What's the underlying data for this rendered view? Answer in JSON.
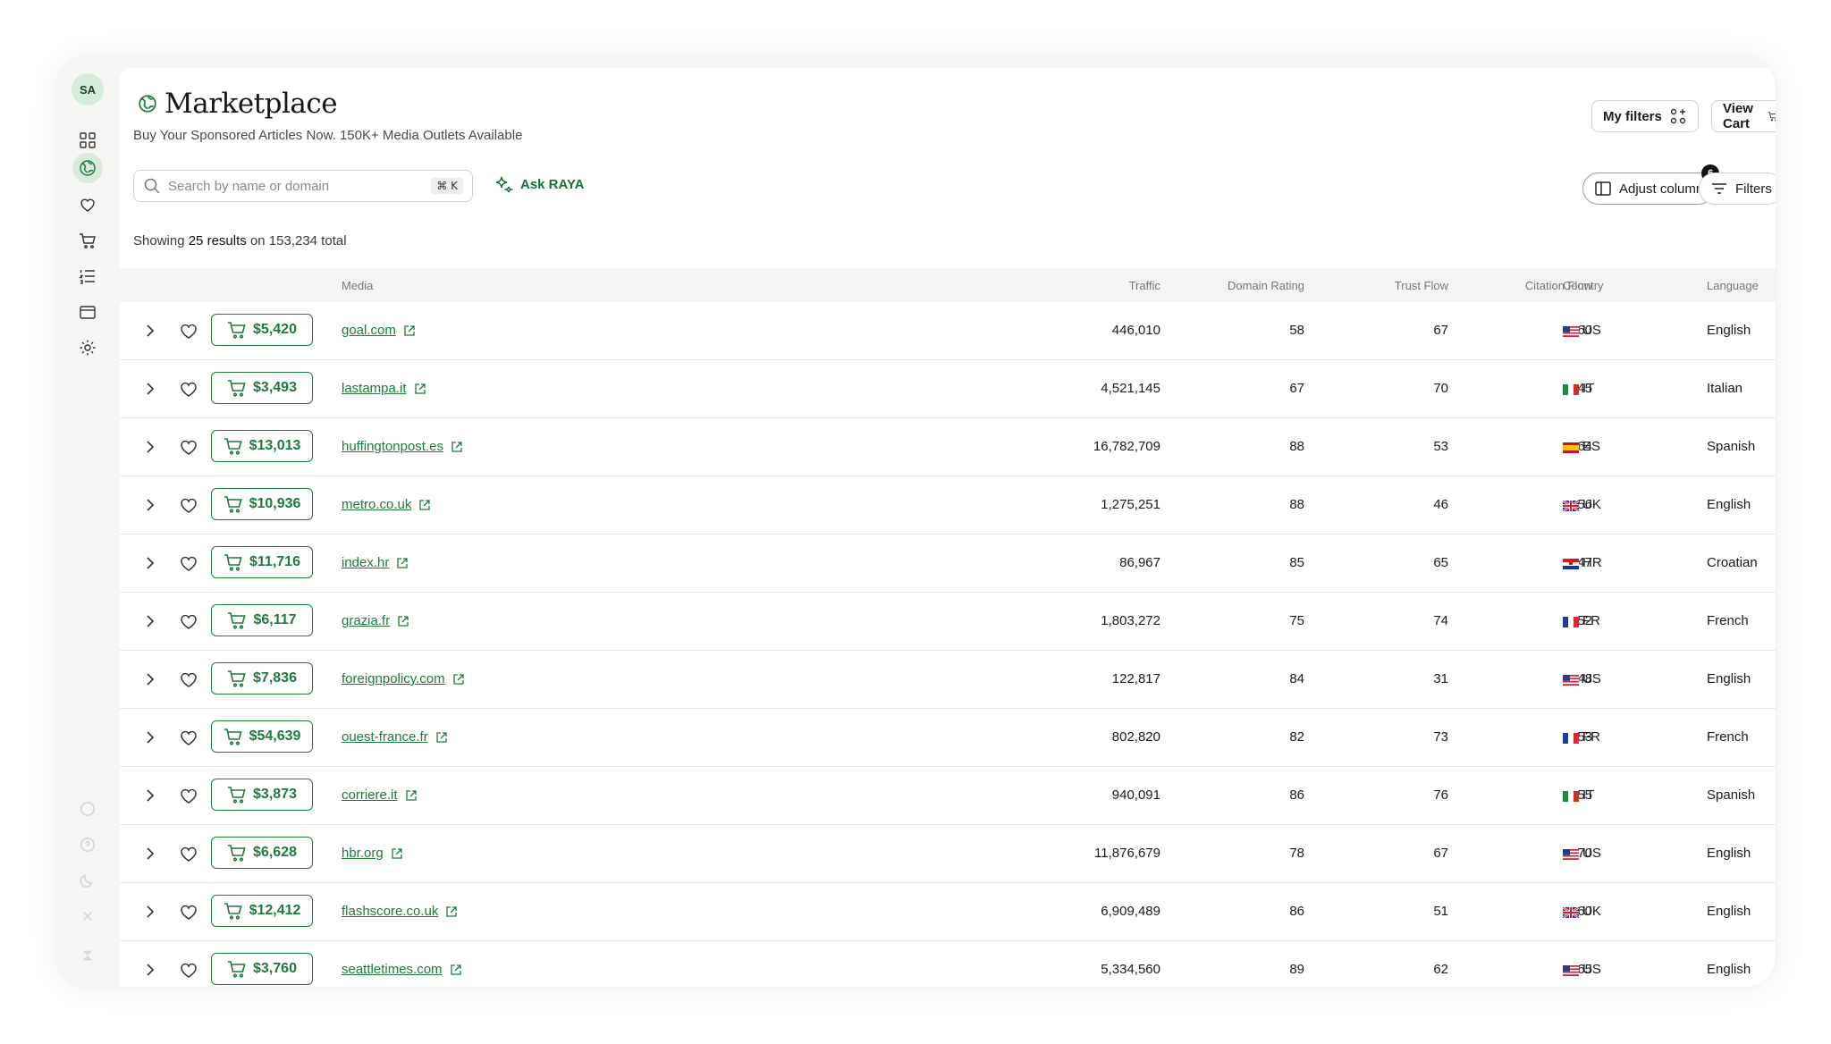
{
  "sidebar": {
    "avatar": "SA",
    "items": [
      "dashboard-icon",
      "globe-icon",
      "heart-icon",
      "cart-icon",
      "list-icon",
      "wallet-icon",
      "gear-icon"
    ]
  },
  "header": {
    "title": "Marketplace",
    "subtitle": "Buy Your Sponsored Articles Now. 150K+ Media Outlets Available",
    "my_filters": "My filters",
    "view_cart": "View Cart"
  },
  "toolbar": {
    "search_placeholder": "Search by name or domain",
    "search_shortcut": "⌘ K",
    "ask_raya": "Ask RAYA",
    "adjust_column": "Adjust column",
    "adjust_badge": "6",
    "filters": "Filters"
  },
  "results": {
    "prefix": "Showing",
    "count": "25 results",
    "suffix": "on 153,234 total"
  },
  "columns": {
    "media": "Media",
    "traffic": "Traffic",
    "domain_rating": "Domain Rating",
    "trust_flow": "Trust Flow",
    "citation_flow": "Citation Flow",
    "country": "Country",
    "language": "Language"
  },
  "rows": [
    {
      "price": "$5,420",
      "domain": "goal.com",
      "traffic": "446,010",
      "dr": "58",
      "tf": "67",
      "cf": "60",
      "flag": "us",
      "country": "US",
      "language": "English"
    },
    {
      "price": "$3,493",
      "domain": "lastampa.it",
      "traffic": "4,521,145",
      "dr": "67",
      "tf": "70",
      "cf": "45",
      "flag": "it",
      "country": "IT",
      "language": "Italian"
    },
    {
      "price": "$13,013",
      "domain": "huffingtonpost.es",
      "traffic": "16,782,709",
      "dr": "88",
      "tf": "53",
      "cf": "64",
      "flag": "es",
      "country": "ES",
      "language": "Spanish"
    },
    {
      "price": "$10,936",
      "domain": "metro.co.uk",
      "traffic": "1,275,251",
      "dr": "88",
      "tf": "46",
      "cf": "56",
      "flag": "uk",
      "country": "UK",
      "language": "English"
    },
    {
      "price": "$11,716",
      "domain": "index.hr",
      "traffic": "86,967",
      "dr": "85",
      "tf": "65",
      "cf": "47",
      "flag": "hr",
      "country": "HR",
      "language": "Croatian"
    },
    {
      "price": "$6,117",
      "domain": "grazia.fr",
      "traffic": "1,803,272",
      "dr": "75",
      "tf": "74",
      "cf": "52",
      "flag": "fr",
      "country": "FR",
      "language": "French"
    },
    {
      "price": "$7,836",
      "domain": "foreignpolicy.com",
      "traffic": "122,817",
      "dr": "84",
      "tf": "31",
      "cf": "48",
      "flag": "us",
      "country": "US",
      "language": "English"
    },
    {
      "price": "$54,639",
      "domain": "ouest-france.fr",
      "traffic": "802,820",
      "dr": "82",
      "tf": "73",
      "cf": "53",
      "flag": "fr",
      "country": "FR",
      "language": "French"
    },
    {
      "price": "$3,873",
      "domain": "corriere.it",
      "traffic": "940,091",
      "dr": "86",
      "tf": "76",
      "cf": "55",
      "flag": "it",
      "country": "IT",
      "language": "Spanish"
    },
    {
      "price": "$6,628",
      "domain": "hbr.org",
      "traffic": "11,876,679",
      "dr": "78",
      "tf": "67",
      "cf": "70",
      "flag": "us",
      "country": "US",
      "language": "English"
    },
    {
      "price": "$12,412",
      "domain": "flashscore.co.uk",
      "traffic": "6,909,489",
      "dr": "86",
      "tf": "51",
      "cf": "60",
      "flag": "uk",
      "country": "UK",
      "language": "English"
    },
    {
      "price": "$3,760",
      "domain": "seattletimes.com",
      "traffic": "5,334,560",
      "dr": "89",
      "tf": "62",
      "cf": "65",
      "flag": "us",
      "country": "US",
      "language": "English"
    }
  ],
  "colors": {
    "accent": "#1f7a3f",
    "active_nav": "#d9eadc",
    "avatar_bg": "#d4ecd9"
  }
}
